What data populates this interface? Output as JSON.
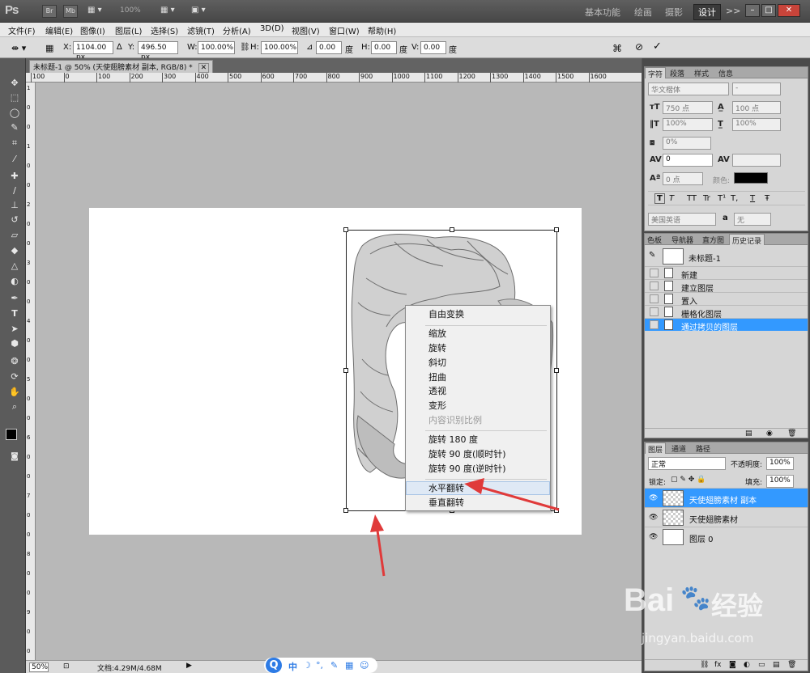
{
  "app": {
    "logo": "Ps",
    "bar_buttons": [
      "Br",
      "Mb"
    ],
    "zoom_dropdown": "100%",
    "workspaces": [
      "基本功能",
      "绘画",
      "摄影",
      "设计"
    ],
    "active_workspace": "设计",
    "more_label": ">>"
  },
  "menu": [
    "文件(F)",
    "编辑(E)",
    "图像(I)",
    "图层(L)",
    "选择(S)",
    "滤镜(T)",
    "分析(A)",
    "3D(D)",
    "视图(V)",
    "窗口(W)",
    "帮助(H)"
  ],
  "options": {
    "x_label": "X:",
    "x_value": "1104.00 px",
    "y_label": "Y:",
    "y_value": "496.50 px",
    "w_label": "W:",
    "w_value": "100.00%",
    "h_label": "H:",
    "h_value": "100.00%",
    "angle_value": "0.00",
    "angle_unit": "度",
    "hskew_label": "H:",
    "hskew_value": "0.00",
    "hskew_unit": "度",
    "vskew_label": "V:",
    "vskew_value": "0.00",
    "vskew_unit": "度"
  },
  "document": {
    "tab_title": "未标题-1 @ 50% (天使翅膀素材 副本, RGB/8) *",
    "close_glyph": "✕"
  },
  "ruler": {
    "h_ticks": [
      "100",
      "0",
      "100",
      "200",
      "300",
      "400",
      "500",
      "600",
      "700",
      "800",
      "900",
      "1000",
      "1100",
      "1200",
      "1300",
      "1400",
      "1500",
      "1600"
    ],
    "v_ticks": [
      "1",
      "0",
      "0",
      "1",
      "0",
      "0",
      "2",
      "0",
      "0",
      "3",
      "0",
      "0",
      "4",
      "0",
      "0",
      "5",
      "0",
      "0",
      "6",
      "0",
      "0",
      "7",
      "0",
      "0",
      "8",
      "0",
      "0",
      "9",
      "0",
      "0"
    ]
  },
  "context_menu": {
    "items": [
      "自由变换",
      "缩放",
      "旋转",
      "斜切",
      "扭曲",
      "透视",
      "变形",
      "内容识别比例",
      "旋转 180 度",
      "旋转 90 度(顺时针)",
      "旋转 90 度(逆时针)",
      "水平翻转",
      "垂直翻转"
    ],
    "disabled_item": "内容识别比例",
    "highlighted_item": "水平翻转"
  },
  "status": {
    "zoom": "50%",
    "doc_size": "文档:4.29M/4.68M"
  },
  "char_panel": {
    "tabs": [
      "字符",
      "段落",
      "样式",
      "信息"
    ],
    "font_family": "华文楷体",
    "font_style": "-",
    "font_size": "750 点",
    "leading": "100 点",
    "v_scale": "100%",
    "h_scale": "100%",
    "baseline_pct": "0%",
    "tracking": "0",
    "baseline_shift": "0 点",
    "color_label": "颜色:",
    "text_color": "#000000",
    "language": "美国英语",
    "aa_label": "a",
    "aa_value": "无",
    "style_buttons": [
      "T",
      "T",
      "TT",
      "Tr",
      "T¹",
      "T,",
      "T",
      "Ŧ"
    ]
  },
  "history_panel": {
    "tabs": [
      "色板",
      "导航器",
      "直方图",
      "历史记录"
    ],
    "snapshot": "未标题-1",
    "items": [
      "新建",
      "建立图层",
      "置入",
      "栅格化图层",
      "通过拷贝的图层"
    ],
    "selected_index": 4
  },
  "layers_panel": {
    "tabs": [
      "图层",
      "通道",
      "路径"
    ],
    "blend_mode": "正常",
    "opacity_label": "不透明度:",
    "opacity": "100%",
    "lock_label": "锁定:",
    "fill_label": "填充:",
    "fill": "100%",
    "layers": [
      "天使翅膀素材 副本",
      "天使翅膀素材",
      "图层 0"
    ],
    "selected_index": 0
  },
  "watermark": {
    "brand": "Bai",
    "brand2": "经验",
    "url": "jingyan.baidu.com"
  },
  "colors": {
    "selection_blue": "#3399ff",
    "annotation_red": "#e03a3a",
    "background_color": "#e06a3a"
  }
}
